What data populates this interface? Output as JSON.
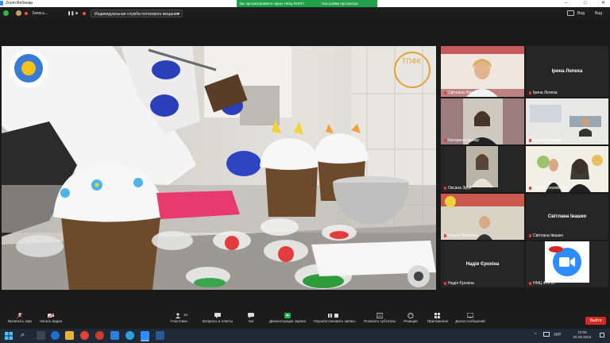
{
  "window": {
    "app_title": "Zoom Вебинар",
    "share_banner": "Вы просматриваете экран НМЦ ФНПО",
    "view_options": "Настройки просмотра"
  },
  "toolbar": {
    "record_label": "Запись...",
    "stream_select": "Индивидуальная служба потокового вещания",
    "view_label": "Вид"
  },
  "participants": [
    {
      "name": "Світлана Ловас",
      "display": "video"
    },
    {
      "name": "Ірина Лепеха",
      "display": "name",
      "center": "Ірина Лепеха"
    },
    {
      "name": "Катерина Шумар",
      "display": "video"
    },
    {
      "name": "Ірина Остапчук",
      "display": "video"
    },
    {
      "name": "Оксана Зруй",
      "display": "video"
    },
    {
      "name": "Марія Коломійчук",
      "display": "video"
    },
    {
      "name": "Ольга Пелехата",
      "display": "video"
    },
    {
      "name": "Світлана Івашко",
      "display": "name",
      "center": "Світлана Івашко"
    },
    {
      "name": "Надія Єрохіна",
      "display": "name",
      "center": "Надія Єрохіна"
    },
    {
      "name": "НМЦ ФНПО",
      "display": "logo"
    }
  ],
  "controls": [
    {
      "label": "Включить звук",
      "icon": "mic-muted-icon"
    },
    {
      "label": "Начать видео",
      "icon": "video-off-icon"
    },
    {
      "label": "Участники",
      "icon": "participants-icon",
      "badge": "10"
    },
    {
      "label": "Вопросы и ответы",
      "icon": "qa-icon"
    },
    {
      "label": "Чат",
      "icon": "chat-icon"
    },
    {
      "label": "Демонстрация экрана",
      "icon": "share-screen-icon"
    },
    {
      "label": "Пауза/остановить запись",
      "icon": "record-icon"
    },
    {
      "label": "Показать субтитры",
      "icon": "cc-icon"
    },
    {
      "label": "Реакции",
      "icon": "reaction-icon"
    },
    {
      "label": "Приложения",
      "icon": "apps-icon"
    },
    {
      "label": "Доска сообщений",
      "icon": "whiteboard-icon"
    }
  ],
  "exit_label": "Выйти",
  "taskbar": {
    "lang": "УКР",
    "time": "10:09",
    "date": "02.05.2024"
  },
  "colors": {
    "share_green": "#1fa14a",
    "exit_red": "#d52b1e",
    "accent_blue": "#2d8cff"
  }
}
